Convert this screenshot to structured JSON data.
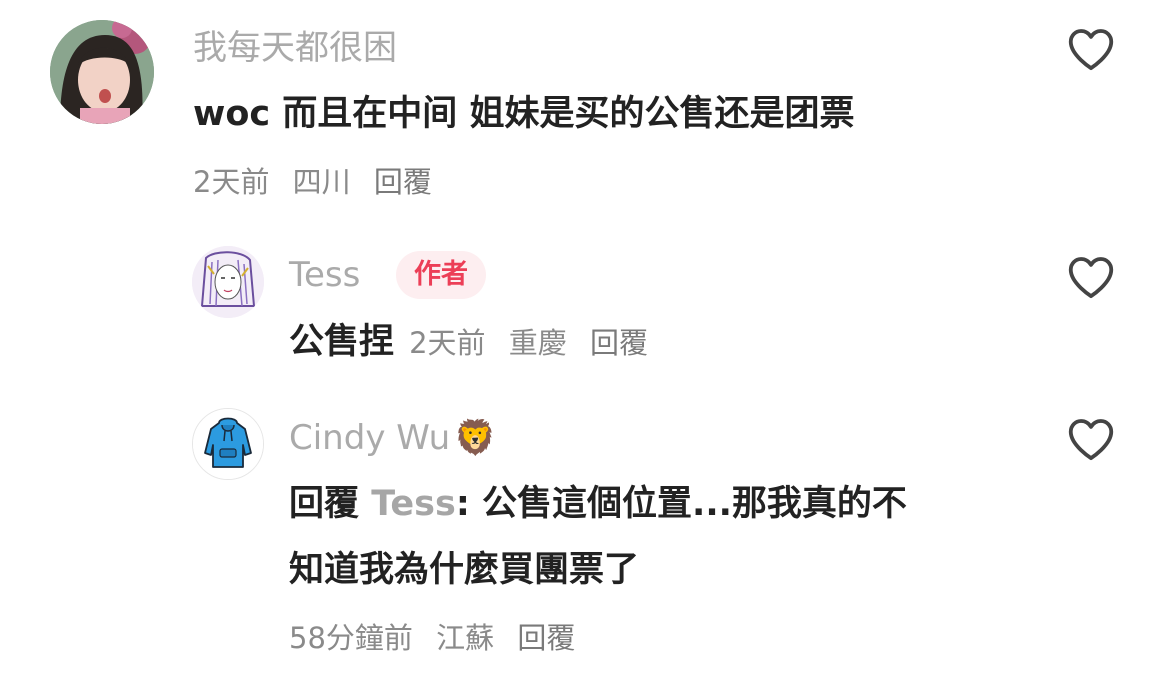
{
  "comments": [
    {
      "username": "我每天都很困",
      "text": "woc 而且在中间 姐妹是买的公售还是团票",
      "time": "2天前",
      "location": "四川",
      "reply_label": "回覆"
    },
    {
      "username": "Tess",
      "badge": "作者",
      "text": "公售捏",
      "time": "2天前",
      "location": "重慶",
      "reply_label": "回覆"
    },
    {
      "username": "Cindy Wu",
      "username_emoji": "🦁",
      "reply_prefix": "回覆",
      "reply_target": "Tess",
      "text_line1": ": 公售這個位置...那我真的不",
      "text_line2": "知道我為什麼買團票了",
      "time": "58分鐘前",
      "location": "江蘇",
      "reply_label": "回覆"
    }
  ],
  "icons": {
    "like": "heart-outline-icon"
  },
  "colors": {
    "username": "#aaaaaa",
    "text": "#222222",
    "meta": "#8a8a8a",
    "author_badge_bg": "#fdeef0",
    "author_badge_text": "#ec3f57"
  }
}
